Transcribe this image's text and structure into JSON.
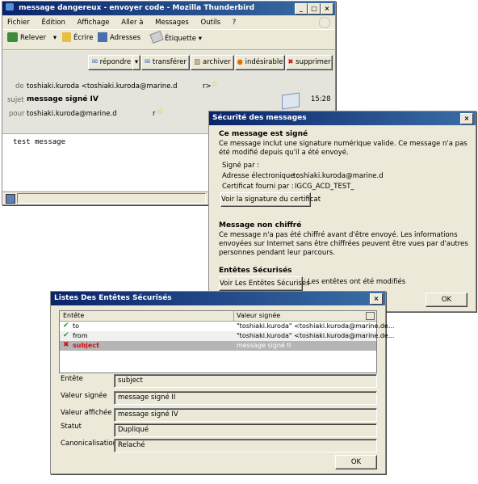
{
  "thunderbird": {
    "title": "message dangereux - envoyer code - Mozilla Thunderbird",
    "menu": [
      "Fichier",
      "Édition",
      "Affichage",
      "Aller à",
      "Messages",
      "Outils",
      "?"
    ],
    "toolbar": {
      "relever": "Relever",
      "ecrire": "Écrire",
      "adresses": "Adresses",
      "etiquette": "Étiquette"
    },
    "actions": {
      "repondre": "répondre",
      "transferer": "transférer",
      "archiver": "archiver",
      "indesirable": "indésirable",
      "supprimer": "supprimer"
    },
    "header": {
      "de_label": "de",
      "de_value": "toshiaki.kuroda <toshiaki.kuroda@marine.d",
      "de_tail": "r>",
      "sujet_label": "sujet",
      "sujet_value": "message signé IV",
      "time": "15:28",
      "pour_label": "pour",
      "pour_value": "toshiaki.kuroda@marine.d",
      "pour_tail": "r"
    },
    "body": "test message"
  },
  "security": {
    "title": "Sécurité des messages",
    "signed_heading": "Ce message est signé",
    "signed_text": "Ce message inclut une signature numérique valide. Ce message n'a pas été modifié depuis qu'il a été envoyé.",
    "signe_par": "Signé par :",
    "adresse_label": "Adresse électronique :",
    "adresse_value": "toshiaki.kuroda@marine.d",
    "cert_label": "Certificat fourni par :",
    "cert_value": "IGCG_ACD_TEST_",
    "voir_sig": "Voir la signature du certificat",
    "unenc_heading": "Message non chiffré",
    "unenc_text": "Ce message n'a pas été chiffré avant d'être envoyé. Les informations envoyées sur Internet sans être chiffrées peuvent être vues par d'autres personnes pendant leur parcours.",
    "entetes_heading": "Entêtes Sécurisés",
    "voir_entetes": "Voir Les Entêtes Sécurisés",
    "entetes_status": "Les entêtes ont été modifiés",
    "ok": "OK"
  },
  "headers_dialog": {
    "title": "Listes Des Entêtes Sécurisés",
    "col_entete": "Entête",
    "col_valeur": "Valeur signée",
    "rows": [
      {
        "name": "to",
        "value": "\"toshiaki.kuroda\" <toshiaki.kuroda@marine.de...",
        "status": "ok"
      },
      {
        "name": "from",
        "value": "\"toshiaki.kuroda\" <toshiaki.kuroda@marine.de...",
        "status": "ok"
      },
      {
        "name": "subject",
        "value": "message signé II",
        "status": "bad"
      }
    ],
    "fields": {
      "entete_label": "Entête",
      "entete_value": "subject",
      "signee_label": "Valeur signée",
      "signee_value": "message signé II",
      "affichee_label": "Valeur affichée",
      "affichee_value": "message signé IV",
      "statut_label": "Statut",
      "statut_value": "Dupliqué",
      "canon_label": "Canonicalisation",
      "canon_value": "Relaché"
    },
    "ok": "OK"
  },
  "colors": {
    "title_start": "#0a246a",
    "title_end": "#3a6ea5",
    "check": "#2a9a2a",
    "error": "#cc1111",
    "selected_row": "#b5b5b5"
  }
}
